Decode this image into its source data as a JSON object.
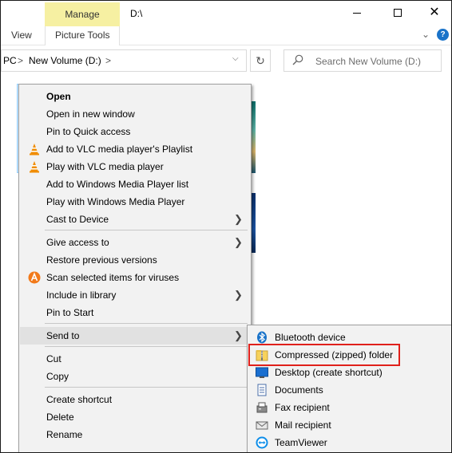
{
  "window": {
    "title": "D:\\",
    "manage_tab": "Manage",
    "controls": {
      "minimize": "minimize",
      "maximize": "maximize",
      "close": "✕"
    }
  },
  "ribbon": {
    "tabs": [
      {
        "label": "View"
      },
      {
        "label": "Picture Tools"
      }
    ],
    "help_label": "?"
  },
  "address": {
    "crumb_pc": "PC",
    "crumb_volume": "New Volume (D:)",
    "separator": ">",
    "refresh": "↻"
  },
  "search": {
    "placeholder": "Search New Volume (D:)"
  },
  "context_menu": {
    "items": [
      {
        "label": "Open",
        "bold": true,
        "icon": ""
      },
      {
        "label": "Open in new window",
        "icon": ""
      },
      {
        "label": "Pin to Quick access",
        "icon": ""
      },
      {
        "label": "Add to VLC media player's Playlist",
        "icon": "vlc-icon"
      },
      {
        "label": "Play with VLC media player",
        "icon": "vlc-icon"
      },
      {
        "label": "Add to Windows Media Player list",
        "icon": ""
      },
      {
        "label": "Play with Windows Media Player",
        "icon": ""
      },
      {
        "label": "Cast to Device",
        "icon": "",
        "submenu": true
      },
      {
        "label": "Give access to",
        "icon": "",
        "submenu": true
      },
      {
        "label": "Restore previous versions",
        "icon": ""
      },
      {
        "label": "Scan selected items for viruses",
        "icon": "avast-icon"
      },
      {
        "label": "Include in library",
        "icon": "",
        "submenu": true
      },
      {
        "label": "Pin to Start",
        "icon": ""
      },
      {
        "label": "Send to",
        "icon": "",
        "submenu": true,
        "active": true
      },
      {
        "label": "Cut",
        "icon": ""
      },
      {
        "label": "Copy",
        "icon": ""
      },
      {
        "label": "Create shortcut",
        "icon": ""
      },
      {
        "label": "Delete",
        "icon": ""
      },
      {
        "label": "Rename",
        "icon": ""
      }
    ]
  },
  "send_to_menu": {
    "items": [
      {
        "label": "Bluetooth device",
        "icon": "bluetooth-icon"
      },
      {
        "label": "Compressed (zipped) folder",
        "icon": "zip-folder-icon",
        "highlighted": true
      },
      {
        "label": "Desktop (create shortcut)",
        "icon": "desktop-icon"
      },
      {
        "label": "Documents",
        "icon": "documents-icon"
      },
      {
        "label": "Fax recipient",
        "icon": "fax-icon"
      },
      {
        "label": "Mail recipient",
        "icon": "mail-icon"
      },
      {
        "label": "TeamViewer",
        "icon": "teamviewer-icon"
      }
    ]
  },
  "colors": {
    "manage_tab": "#f6f0a2",
    "selection": "#cce8ff",
    "menu_bg": "#f2f2f2",
    "highlight_border": "#e0201b",
    "vlc_orange": "#f08c00",
    "avast_orange": "#f27a1a"
  }
}
